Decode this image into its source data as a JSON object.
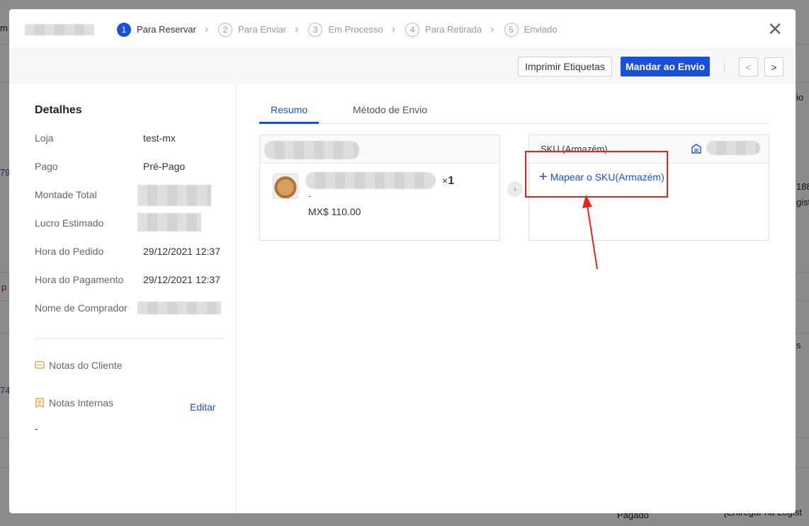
{
  "background": {
    "texts": [
      "m I",
      "79",
      "p",
      "74",
      "io",
      "188",
      "gist",
      "s",
      "Pagado",
      "[Entregar na Logist"
    ]
  },
  "header": {
    "steps": [
      {
        "num": "1",
        "label": "Para Reservar",
        "active": true
      },
      {
        "num": "2",
        "label": "Para Enviar",
        "active": false
      },
      {
        "num": "3",
        "label": "Em Processo",
        "active": false
      },
      {
        "num": "4",
        "label": "Para Retirada",
        "active": false
      },
      {
        "num": "5",
        "label": "Enviado",
        "active": false
      }
    ],
    "close": "✕"
  },
  "toolbar": {
    "print_label": "Imprimir Etiquetas",
    "send_label": "Mandar ao Envio",
    "prev": "<",
    "next": ">"
  },
  "details": {
    "title": "Detalhes",
    "rows": [
      {
        "key": "Loja",
        "value": "test-mx"
      },
      {
        "key": "Pago",
        "value": "Pré-Pago"
      },
      {
        "key": "Montade Total",
        "value": ""
      },
      {
        "key": "Lucro Estimado",
        "value": ""
      },
      {
        "key": "Hora do Pedido",
        "value": "29/12/2021 12:37"
      },
      {
        "key": "Hora do Pagamento",
        "value": "29/12/2021 12:37"
      },
      {
        "key": "Nome de Comprador",
        "value": ""
      }
    ],
    "client_notes": "Notas do Cliente",
    "internal_notes": "Notas Internas",
    "edit": "Editar",
    "internal_notes_value": "-"
  },
  "tabs": [
    "Resumo",
    "Método de Envio"
  ],
  "product": {
    "qty_prefix": "×",
    "qty": "1",
    "variant": "-",
    "price": "MX$ 110.00"
  },
  "sku": {
    "title": "SKU (Armazém)",
    "map_label": "Mapear o SKU(Armazém)"
  },
  "colors": {
    "primary": "#1a4fd8",
    "annotation": "#e8231f"
  }
}
